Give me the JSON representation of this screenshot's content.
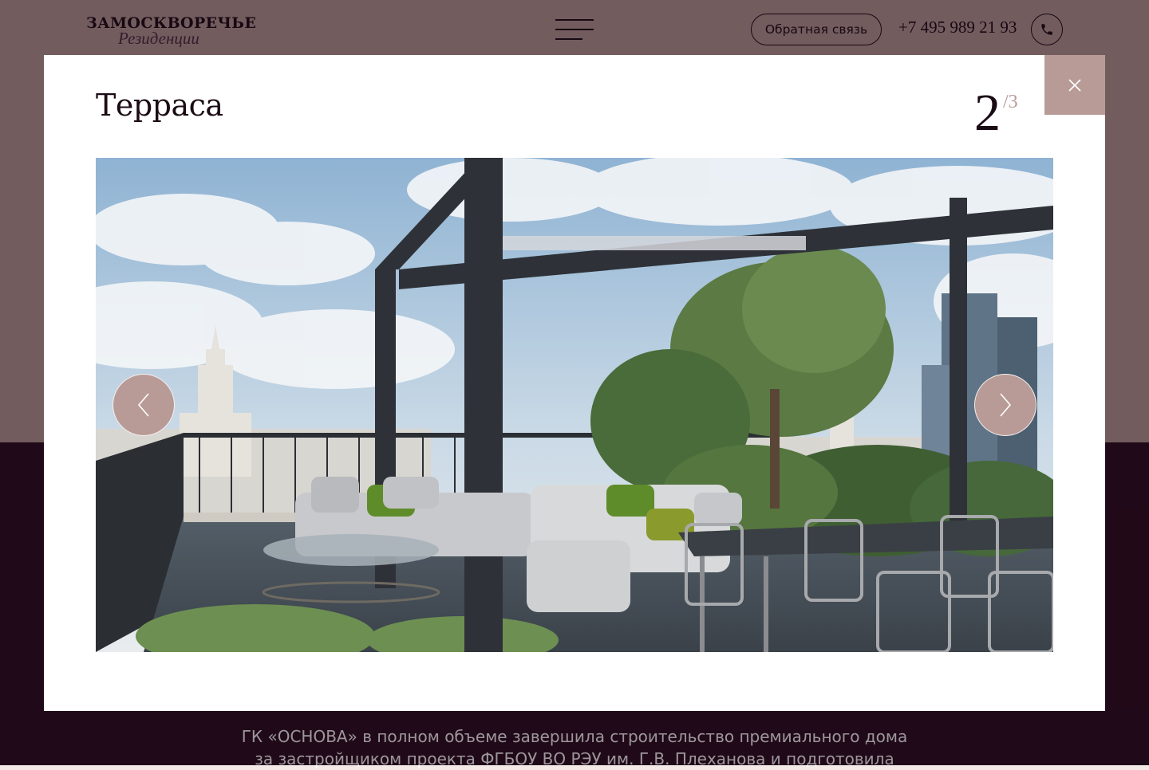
{
  "header": {
    "logo_main": "ЗАМОСКВОРЕЧЬЕ",
    "logo_sub": "Резиденции",
    "feedback_button": "Обратная связь",
    "phone": "+7 495 989 21 93"
  },
  "background": {
    "text_line1": "ГК «ОСНОВА» в полном объеме завершила строительство премиального дома",
    "text_line2": "за застройщиком проекта ФГБОУ ВО РЭУ им. Г.В. Плеханова и подготовила"
  },
  "modal": {
    "title": "Терраса",
    "counter_current": "2",
    "counter_total": "/3",
    "image_subject": "Rooftop terrace with pergola, sofas, dining table and Moscow skyline"
  },
  "icons": [
    "menu-icon",
    "phone-icon",
    "close-icon",
    "chevron-left-icon",
    "chevron-right-icon"
  ],
  "colors": {
    "accent": "#b89b96",
    "dark": "#1b0b14",
    "page_dark": "#2a0d1e",
    "page_light": "#b89b96",
    "modal_bg": "#ffffff"
  }
}
